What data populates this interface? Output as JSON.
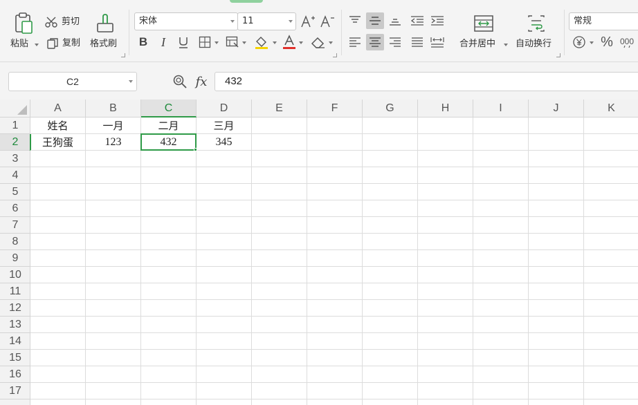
{
  "ribbon": {
    "clipboard": {
      "paste_label": "粘贴",
      "cut_label": "剪切",
      "copy_label": "复制",
      "format_painter_label": "格式刷"
    },
    "font": {
      "family": "宋体",
      "size": "11"
    },
    "alignment": {
      "merge_center_label": "合并居中",
      "wrap_text_label": "自动换行"
    },
    "number": {
      "format": "常规"
    }
  },
  "formula_bar": {
    "name_box": "C2",
    "fx_label": "fx",
    "formula_value": "432"
  },
  "sheet": {
    "columns": [
      "A",
      "B",
      "C",
      "D",
      "E",
      "F",
      "G",
      "H",
      "I",
      "J",
      "K"
    ],
    "rows": [
      "1",
      "2",
      "3",
      "4",
      "5",
      "6",
      "7",
      "8",
      "9",
      "10",
      "11",
      "12",
      "13",
      "14",
      "15",
      "16",
      "17"
    ],
    "cells": {
      "A1": "姓名",
      "B1": "一月",
      "C1": "二月",
      "D1": "三月",
      "A2": "王狗蛋",
      "B2": "123",
      "C2": "432",
      "D2": "345"
    },
    "selected_column": "C",
    "selected_row": "2"
  },
  "colors": {
    "accent_green": "#2e9a47",
    "font_color_red": "#e0302b",
    "fill_color_yellow": "#f5d300"
  }
}
